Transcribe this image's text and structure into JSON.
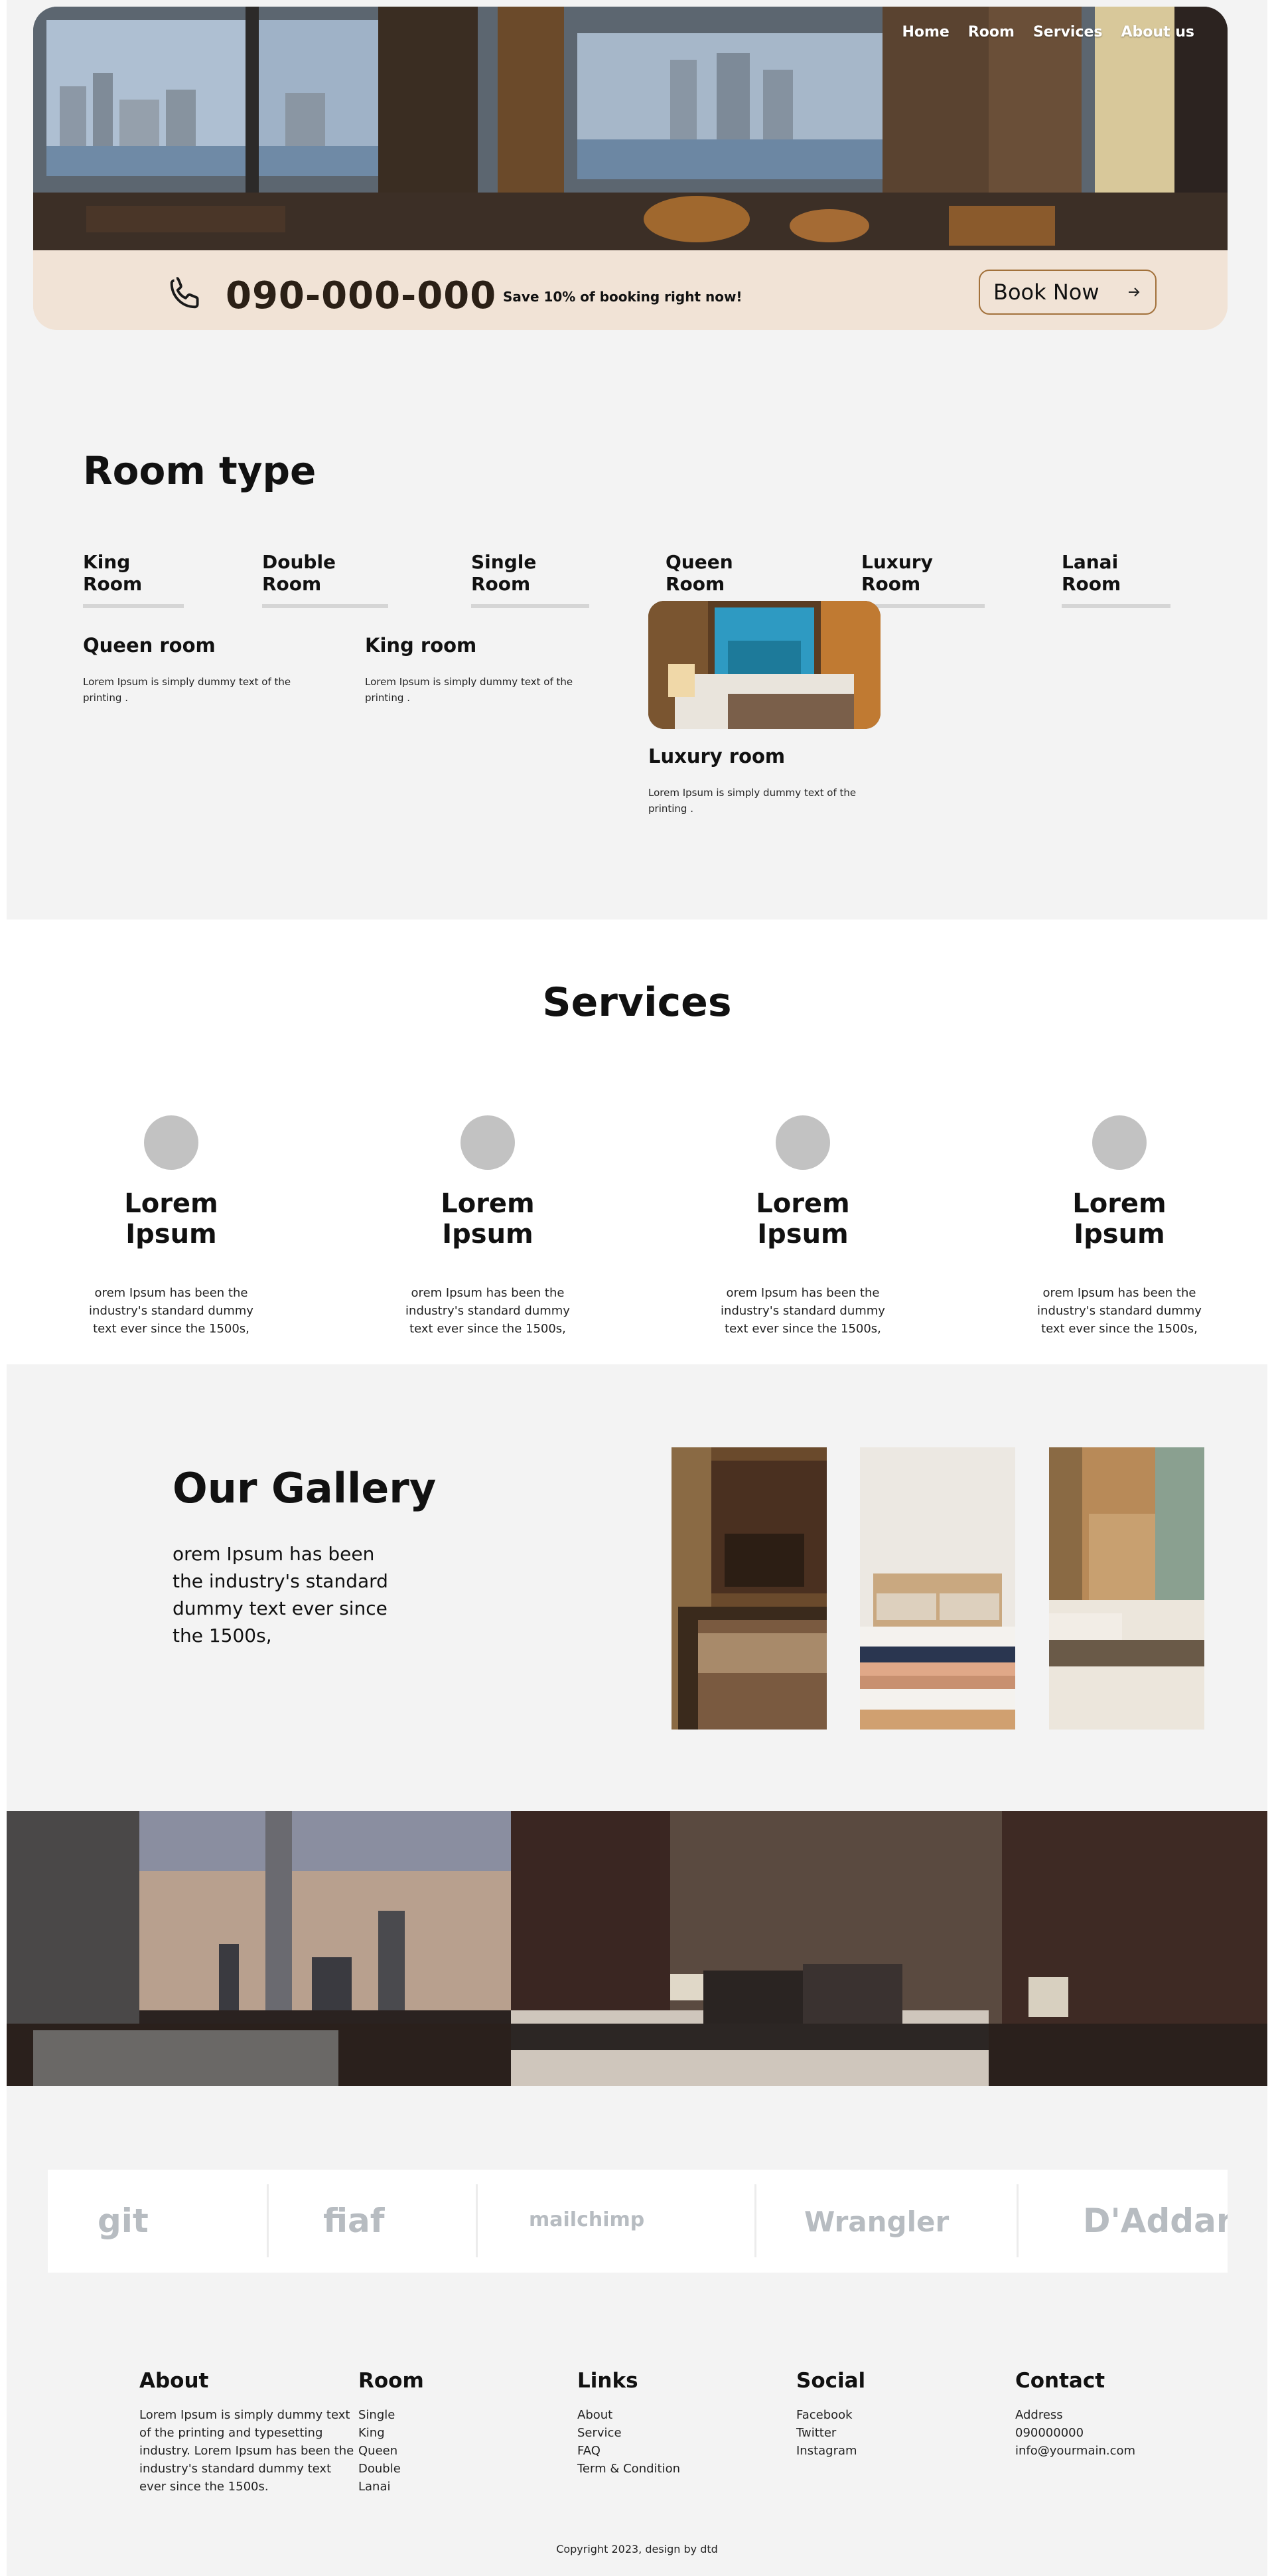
{
  "nav": {
    "items": [
      "Home",
      "Room",
      "Services",
      "About us"
    ]
  },
  "booking": {
    "phone": "090-000-000",
    "promo": "Save 10% of booking right now!",
    "book_label": "Book Now"
  },
  "rooms": {
    "title": "Room type",
    "tabs": [
      "King Room",
      "Double Room",
      "Single Room",
      "Queen Room",
      "Luxury Room",
      "Lanai Room"
    ],
    "cards": [
      {
        "title": "Queen room",
        "text": "Lorem Ipsum is simply dummy text of the printing ."
      },
      {
        "title": "King room",
        "text": "Lorem Ipsum is simply dummy text of the printing ."
      },
      {
        "title": "Luxury room",
        "text": "Lorem Ipsum is simply dummy text of the printing ."
      }
    ]
  },
  "services": {
    "title": "Services",
    "items": [
      {
        "title": "Lorem Ipsum",
        "text": "orem Ipsum has been the industry's standard dummy text ever since the 1500s,"
      },
      {
        "title": "Lorem Ipsum",
        "text": "orem Ipsum has been the industry's standard dummy text ever since the 1500s,"
      },
      {
        "title": "Lorem Ipsum",
        "text": "orem Ipsum has been the industry's standard dummy text ever since the 1500s,"
      },
      {
        "title": "Lorem Ipsum",
        "text": "orem Ipsum has been the industry's standard dummy text ever since the 1500s,"
      }
    ]
  },
  "gallery": {
    "title": "Our Gallery",
    "text": "orem Ipsum has been the industry's standard dummy text ever since the 1500s,"
  },
  "logos": [
    "git",
    "fiaf",
    "mailchimp",
    "Wrangler",
    "D'Addario"
  ],
  "footer": {
    "about": {
      "title": "About",
      "text": "Lorem Ipsum is simply dummy text of the printing and typesetting industry. Lorem Ipsum has been the industry's standard dummy text ever since the 1500s."
    },
    "room": {
      "title": "Room",
      "items": [
        "Single",
        "King",
        "Queen",
        "Double",
        "Lanai"
      ]
    },
    "links": {
      "title": "Links",
      "items": [
        "About",
        "Service",
        "FAQ",
        "Term & Condition"
      ]
    },
    "social": {
      "title": "Social",
      "items": [
        "Facebook",
        "Twitter",
        "Instagram"
      ]
    },
    "contact": {
      "title": "Contact",
      "items": [
        "Address",
        "090000000",
        "info@yourmain.com"
      ]
    },
    "copyright": "Copyright 2023, design by dtd"
  },
  "colors": {
    "accent_beige": "#f1e3d6",
    "button_border": "#a2713b",
    "page_bg": "#f3f3f3",
    "tab_underline": "#d5d5d5",
    "service_dot": "#c2c2c2"
  }
}
